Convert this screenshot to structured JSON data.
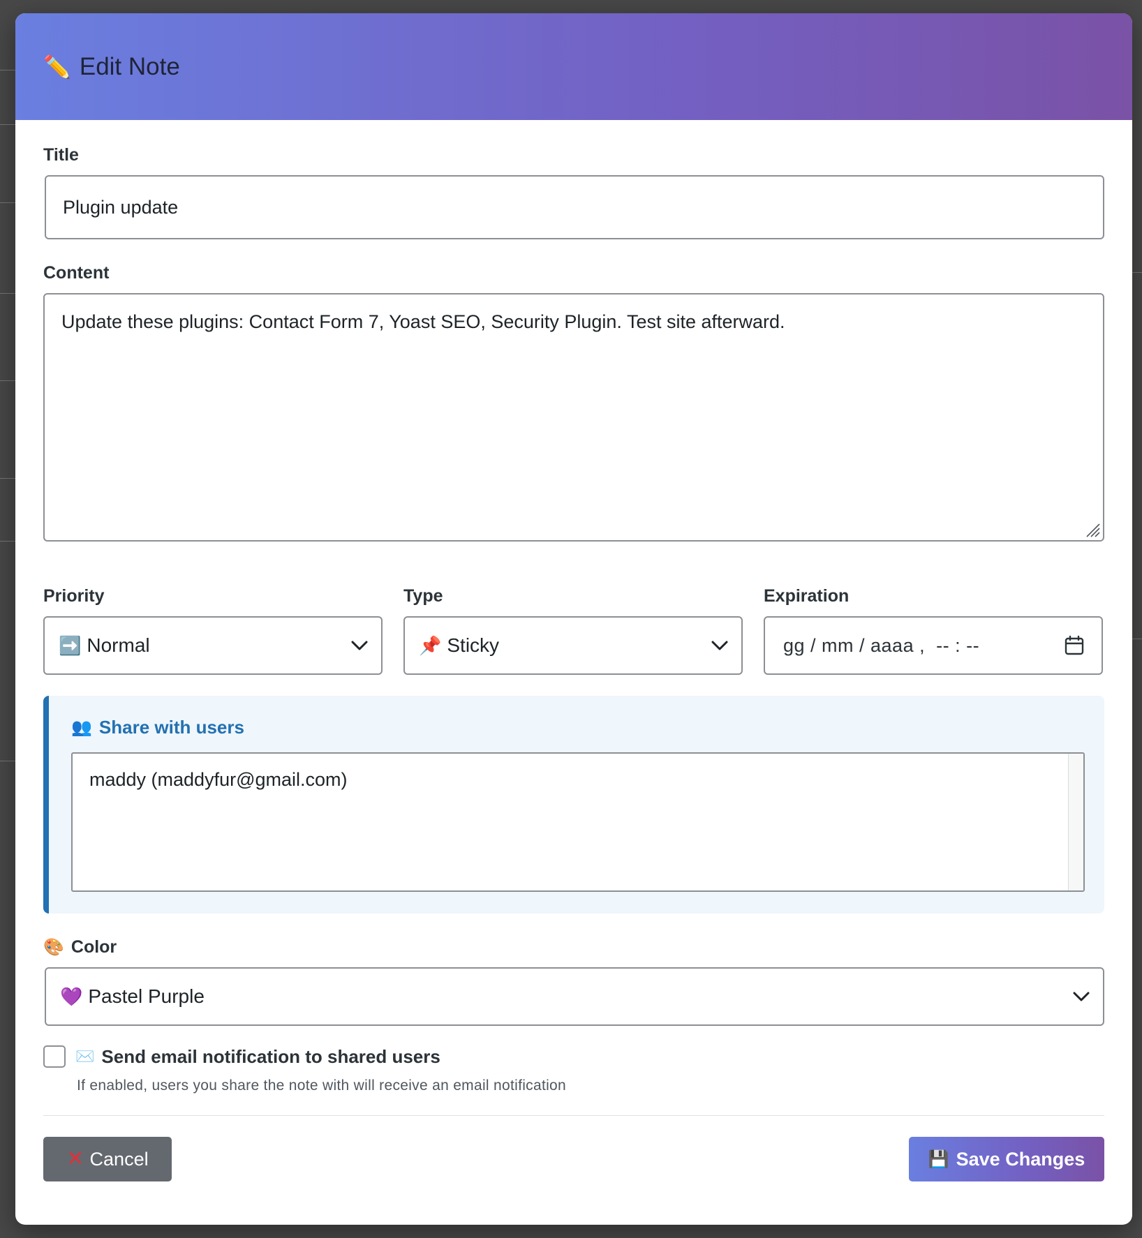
{
  "modal": {
    "title": "Edit Note",
    "title_icon": "pencil-icon"
  },
  "form": {
    "title_label": "Title",
    "title_value": "Plugin update",
    "content_label": "Content",
    "content_value": "Update these plugins: Contact Form 7, Yoast SEO, Security Plugin. Test site afterward.",
    "priority_label": "Priority",
    "priority_value": "Normal",
    "priority_icon": "right-arrow-icon",
    "type_label": "Type",
    "type_value": "Sticky",
    "type_icon": "pushpin-icon",
    "expiration_label": "Expiration",
    "expiration_placeholder": "gg / mm / aaaa ,  -- : --",
    "share_title": "Share with users",
    "share_icon": "users-icon",
    "share_users": [
      "maddy (maddyfur@gmail.com)"
    ],
    "color_label": "Color",
    "color_icon": "palette-icon",
    "color_value": "Pastel Purple",
    "color_value_icon": "purple-heart-icon",
    "email_label": "Send email notification to shared users",
    "email_icon": "envelope-icon",
    "email_checked": false,
    "email_help": "If enabled, users you share the note with will receive an email notification"
  },
  "footer": {
    "cancel_label": "Cancel",
    "save_label": "Save Changes"
  },
  "colors": {
    "header_start": "#6a7fe0",
    "header_end": "#7a52a6",
    "accent_blue": "#2271b1",
    "cancel_bg": "#646970"
  }
}
